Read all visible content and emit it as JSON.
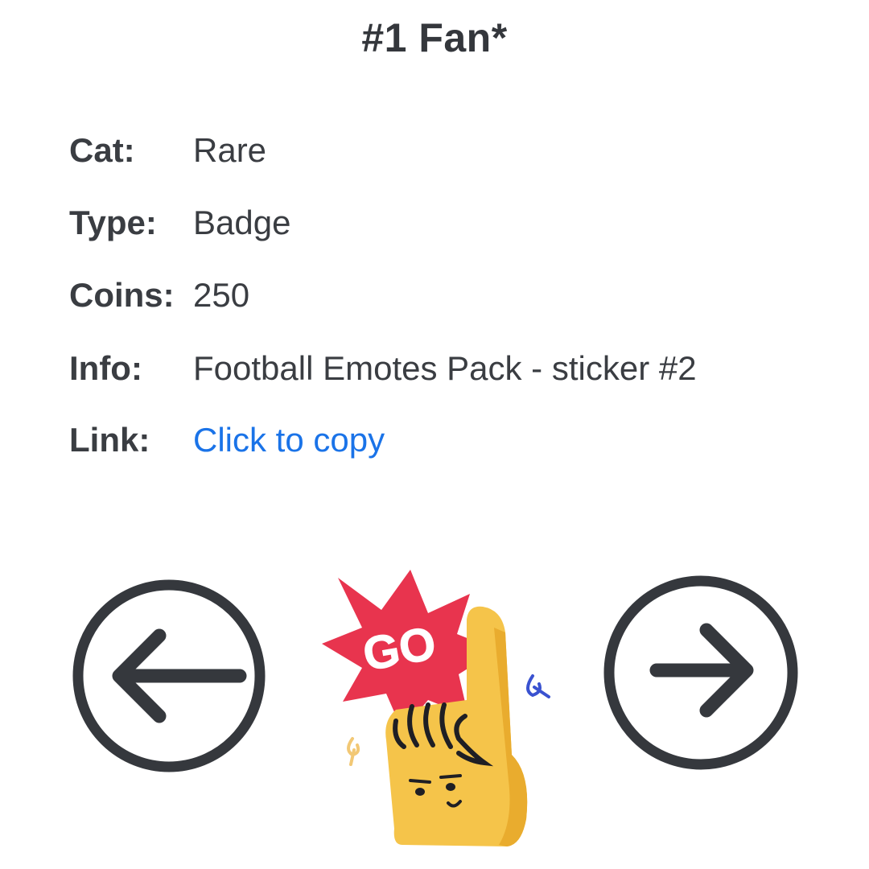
{
  "title": "#1 Fan*",
  "info": {
    "cat_label": "Cat:",
    "cat_value": "Rare",
    "type_label": "Type:",
    "type_value": "Badge",
    "coins_label": "Coins:",
    "coins_value": "250",
    "info_label": "Info:",
    "info_value": "Football Emotes Pack - sticker #2",
    "link_label": "Link:",
    "link_value": "Click to copy"
  },
  "sticker": {
    "text": "GO",
    "icon": "foam-finger-sticker"
  },
  "navigation": {
    "prev_icon": "arrow-left-circle-icon",
    "next_icon": "arrow-right-circle-icon"
  },
  "colors": {
    "text": "#3a3d42",
    "link": "#1a73e8",
    "burst": "#e8344e",
    "finger": "#f5c44a"
  }
}
